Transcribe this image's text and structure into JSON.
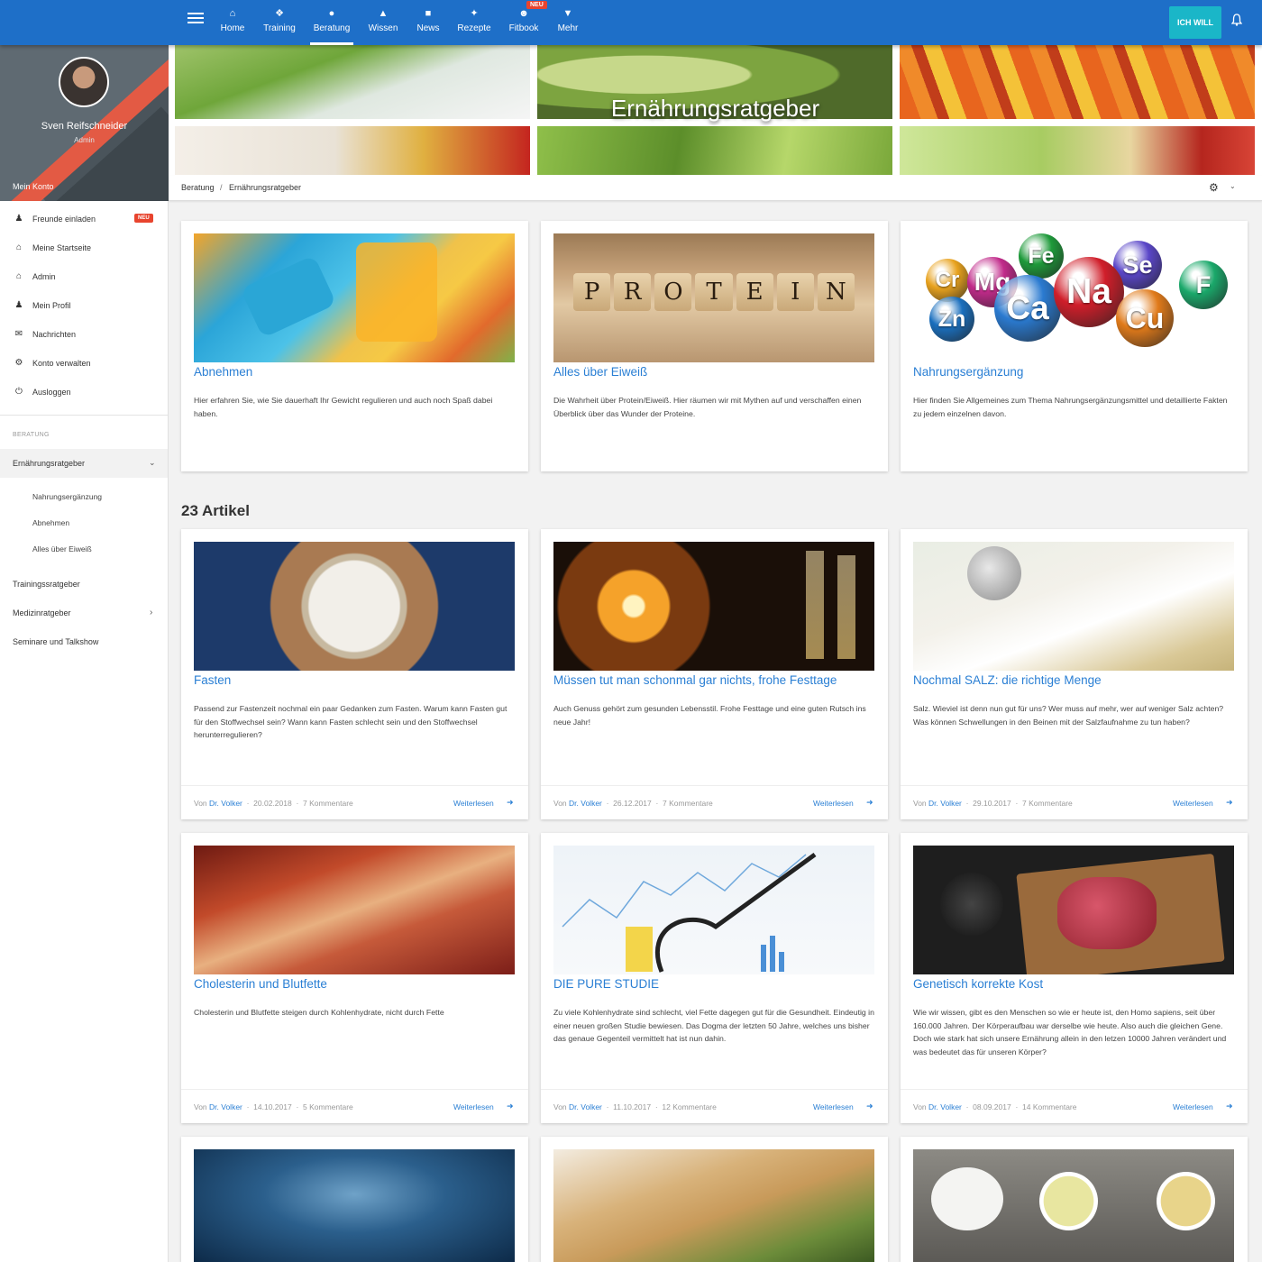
{
  "nav": {
    "items": [
      {
        "label": "Home",
        "icon": "home-icon"
      },
      {
        "label": "Training",
        "icon": "training-icon"
      },
      {
        "label": "Beratung",
        "icon": "beratung-icon"
      },
      {
        "label": "Wissen",
        "icon": "graduation-cap-icon"
      },
      {
        "label": "News",
        "icon": "news-icon"
      },
      {
        "label": "Rezepte",
        "icon": "cutlery-icon"
      },
      {
        "label": "Fitbook",
        "icon": "users-icon",
        "badge": "NEU"
      },
      {
        "label": "Mehr",
        "icon": "chevron-circle-icon"
      }
    ],
    "cta": "ICH WILL"
  },
  "profile": {
    "name": "Sven Reifschneider",
    "role": "Admin",
    "account_label": "Mein Konto"
  },
  "sidebar": {
    "items": [
      {
        "label": "Freunde einladen",
        "badge": "NEU"
      },
      {
        "label": "Meine Startseite"
      },
      {
        "label": "Admin"
      },
      {
        "label": "Mein Profil"
      },
      {
        "label": "Nachrichten"
      },
      {
        "label": "Konto verwalten"
      },
      {
        "label": "Ausloggen"
      }
    ],
    "section": "BERATUNG",
    "group": "Ernährungsratgeber",
    "subitems": [
      "Nahrungsergänzung",
      "Abnehmen",
      "Alles über Eiweiß"
    ],
    "more": [
      "Trainingssratgeber",
      "Medizinratgeber",
      "Seminare und Talkshow"
    ]
  },
  "banner": {
    "title": "Ernährungsratgeber"
  },
  "breadcrumb": {
    "parent": "Beratung",
    "sep": "/",
    "current": "Ernährungsratgeber"
  },
  "featured": [
    {
      "title": "Abnehmen",
      "desc": "Hier erfahren Sie, wie Sie dauerhaft Ihr Gewicht regulieren und auch noch Spaß dabei haben."
    },
    {
      "title": "Alles über Eiweiß",
      "desc": "Die Wahrheit über Protein/Eiweiß. Hier räumen wir mit Mythen auf und verschaffen einen Überblick über das Wunder der Proteine."
    },
    {
      "title": "Nahrungsergänzung",
      "desc": "Hier finden Sie Allgemeines zum Thema Nahrungsergänzungsmittel und detaillierte Fakten zu jedem einzelnen davon."
    }
  ],
  "article_count": "23 Artikel",
  "articles": [
    {
      "title": "Fasten",
      "desc": "Passend zur Fastenzeit nochmal ein paar Gedanken zum Fasten. Warum kann Fasten gut für den Stoffwechsel sein? Wann kann Fasten schlecht sein und den Stoffwechsel herunterregulieren?",
      "by": "Von",
      "author": "Dr. Volker",
      "date": "20.02.2018",
      "comments": "7 Kommentare",
      "more": "Weiterlesen"
    },
    {
      "title": "Müssen tut man schonmal gar nichts, frohe Festtage",
      "desc": "Auch Genuss gehört zum gesunden Lebensstil. Frohe Festtage und eine guten Rutsch ins neue Jahr!",
      "by": "Von",
      "author": "Dr. Volker",
      "date": "26.12.2017",
      "comments": "7 Kommentare",
      "more": "Weiterlesen"
    },
    {
      "title": "Nochmal SALZ: die richtige Menge",
      "desc": "Salz. Wieviel ist denn nun gut für uns? Wer muss auf mehr, wer auf weniger Salz achten? Was können Schwellungen in den Beinen mit der Salzfaufnahme zu tun haben?",
      "by": "Von",
      "author": "Dr. Volker",
      "date": "29.10.2017",
      "comments": "7 Kommentare",
      "more": "Weiterlesen"
    },
    {
      "title": "Cholesterin und Blutfette",
      "desc": "Cholesterin und Blutfette steigen durch Kohlenhydrate, nicht durch Fette",
      "by": "Von",
      "author": "Dr. Volker",
      "date": "14.10.2017",
      "comments": "5 Kommentare",
      "more": "Weiterlesen"
    },
    {
      "title": "DIE PURE STUDIE",
      "desc": "Zu viele Kohlenhydrate sind schlecht, viel Fette dagegen gut für die Gesundheit. Eindeutig in einer neuen großen Studie bewiesen. Das Dogma der letzten 50 Jahre, welches uns bisher das genaue Gegenteil vermittelt hat ist nun dahin.",
      "by": "Von",
      "author": "Dr. Volker",
      "date": "11.10.2017",
      "comments": "12 Kommentare",
      "more": "Weiterlesen"
    },
    {
      "title": "Genetisch korrekte Kost",
      "desc": "Wie wir wissen, gibt es den Menschen so wie er heute ist, den Homo sapiens, seit über 160.000 Jahren. Der Körperaufbau war derselbe wie heute. Also auch die gleichen Gene. Doch wie stark hat sich unsere Ernährung allein in den letzen 10000 Jahren verändert und was bedeutet das für unseren Körper?",
      "by": "Von",
      "author": "Dr. Volker",
      "date": "08.09.2017",
      "comments": "14 Kommentare",
      "more": "Weiterlesen"
    }
  ],
  "feature_letters": {
    "protein": [
      "P",
      "R",
      "O",
      "T",
      "E",
      "I",
      "N"
    ],
    "minerals": [
      "Cr",
      "Mg",
      "Fe",
      "Se",
      "Zn",
      "Ca",
      "Na",
      "F",
      "Cu"
    ]
  }
}
